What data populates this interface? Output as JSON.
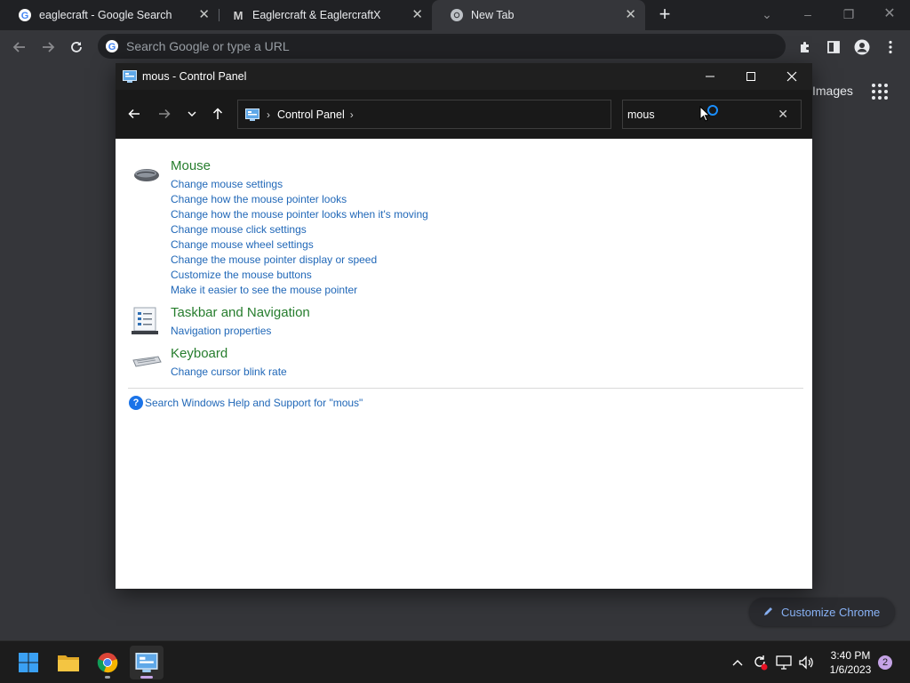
{
  "browser": {
    "tabs": [
      {
        "title": "eaglecraft - Google Search",
        "favicon": "google-g-icon"
      },
      {
        "title": "Eaglercraft & EaglercraftX",
        "favicon": "m-letter-icon"
      },
      {
        "title": "New Tab",
        "favicon": "chrome-icon"
      }
    ],
    "new_tab": "+",
    "omnibox_placeholder": "Search Google or type a URL",
    "ntp_images_link": "Images",
    "customize_label": "Customize Chrome"
  },
  "control_panel": {
    "title": "mous - Control Panel",
    "breadcrumb": "Control Panel",
    "search_value": "mous",
    "groups": [
      {
        "title": "Mouse",
        "icon": "mouse-icon",
        "links": [
          "Change mouse settings",
          "Change how the mouse pointer looks",
          "Change how the mouse pointer looks when it's moving",
          "Change mouse click settings",
          "Change mouse wheel settings",
          "Change the mouse pointer display or speed",
          "Customize the mouse buttons",
          "Make it easier to see the mouse pointer"
        ]
      },
      {
        "title": "Taskbar and Navigation",
        "icon": "taskbar-icon",
        "links": [
          "Navigation properties"
        ]
      },
      {
        "title": "Keyboard",
        "icon": "keyboard-icon",
        "links": [
          "Change cursor blink rate"
        ]
      }
    ],
    "help_text": "Search Windows Help and Support for \"mous\""
  },
  "taskbar": {
    "time": "3:40 PM",
    "date": "1/6/2023",
    "notification_count": "2"
  },
  "colors": {
    "link": "#2168b8",
    "group_title": "#267d2d",
    "chrome_dark": "#202124",
    "accent_blue": "#8ab4f8"
  }
}
